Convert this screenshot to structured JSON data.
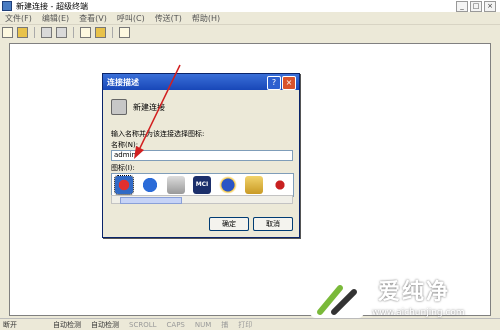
{
  "window": {
    "title": "新建连接 - 超级终端",
    "min": "_",
    "max": "□",
    "close": "×"
  },
  "menu": [
    "文件(F)",
    "编辑(E)",
    "查看(V)",
    "呼叫(C)",
    "传送(T)",
    "帮助(H)"
  ],
  "status": [
    "断开",
    "自动检测",
    "自动检测",
    "SCROLL",
    "CAPS",
    "NUM",
    "捕",
    "打印"
  ],
  "dialog": {
    "title": "连接描述",
    "help": "?",
    "close": "×",
    "connection_name": "新建连接",
    "prompt": "输入名称并为该连接选择图标:",
    "name_label": "名称(N):",
    "name_value": "admin",
    "icon_label": "图标(I):",
    "icons": [
      "red-phone-icon",
      "globe-icon",
      "phone-icon",
      "mci-icon",
      "globe-star-icon",
      "folder-phone-icon",
      "phone-pin-icon"
    ],
    "icon_mci_text": "MCI",
    "ok": "确定",
    "cancel": "取消"
  },
  "watermark": {
    "brand": "爱纯净",
    "url": "www.aichunjing.com"
  },
  "colors": {
    "titlebar_blue": "#1847b8",
    "arrow_red": "#d21f1f",
    "selection": "#316ac5"
  }
}
